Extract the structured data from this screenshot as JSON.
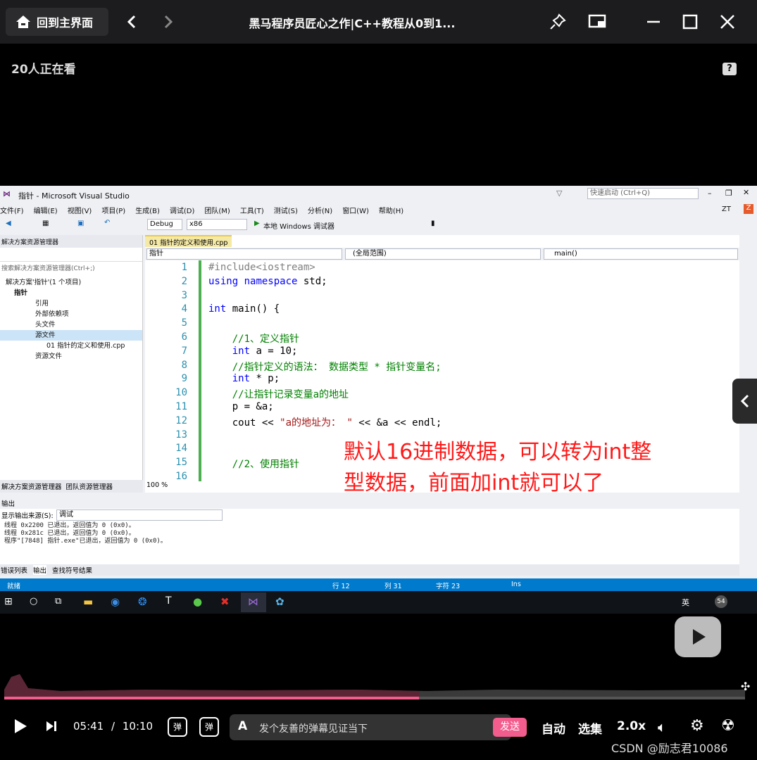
{
  "topbar": {
    "home_label": "回到主界面",
    "title": "黑马程序员匠心之作|C++教程从0到1..."
  },
  "viewers": "20人正在看",
  "vs": {
    "window_title": "指针 - Microsoft Visual Studio",
    "quick_launch": "快速启动 (Ctrl+Q)",
    "user": "ZT",
    "menu": [
      "文件(F)",
      "编辑(E)",
      "视图(V)",
      "项目(P)",
      "生成(B)",
      "调试(D)",
      "团队(M)",
      "工具(T)",
      "测试(S)",
      "分析(N)",
      "窗口(W)",
      "帮助(H)"
    ],
    "config": "Debug",
    "platform": "x86",
    "run_label": "本地 Windows 调试器",
    "solution_explorer": {
      "title": "解决方案资源管理器",
      "search": "搜索解决方案资源管理器(Ctrl+;)",
      "items": [
        "解决方案'指针'(1 个项目)",
        "指针",
        "引用",
        "外部依赖项",
        "头文件",
        "源文件",
        "01 指针的定义和使用.cpp",
        "资源文件"
      ],
      "tabs": [
        "解决方案资源管理器",
        "团队资源管理器"
      ]
    },
    "editor": {
      "tab": "01 指针的定义和使用.cpp",
      "nav_project": "指针",
      "nav_scope": "(全局范围)",
      "nav_func": "main()",
      "zoom": "100 %",
      "lines": [
        "1",
        "2",
        "3",
        "4",
        "5",
        "6",
        "7",
        "8",
        "9",
        "10",
        "11",
        "12",
        "13",
        "14",
        "15",
        "16"
      ],
      "code": [
        "#include<iostream>",
        "using namespace std;",
        "",
        "int main() {",
        "",
        "    //1、定义指针",
        "    int a = 10;",
        "    //指针定义的语法： 数据类型 * 指针变量名;",
        "    int * p;",
        "    //让指针记录变量a的地址",
        "    p = &a;",
        "    cout << \"a的地址为： \" << &a << endl;",
        "",
        "",
        "    //2、使用指针",
        ""
      ]
    },
    "overlay": [
      "默认16进制数据，可以转为int整",
      "型数据，前面加int就可以了"
    ],
    "output": {
      "title": "输出",
      "source_label": "显示输出来源(S):",
      "source": "调试",
      "lines": [
        "线程 0x2200 已退出，返回值为 0 (0x0)。",
        "线程 0x281c 已退出，返回值为 0 (0x0)。",
        "程序\"[7848] 指针.exe\"已退出，返回值为 0 (0x0)。"
      ],
      "tabs": [
        "错误列表",
        "输出",
        "查找符号结果"
      ]
    },
    "status": {
      "ready": "就绪",
      "row": "行 12",
      "col": "列 31",
      "char": "字符 23",
      "ins": "Ins"
    },
    "tray": {
      "ime": "英",
      "count": "54"
    }
  },
  "player": {
    "time_current": "05:41",
    "time_sep": "/",
    "time_total": "10:10",
    "progress": 0.56,
    "danmaku_placeholder": "发个友善的弹幕见证当下",
    "send": "发送",
    "auto": "自动",
    "episodes": "选集",
    "speed": "2.0x"
  },
  "watermark": "CSDN @励志君10086"
}
